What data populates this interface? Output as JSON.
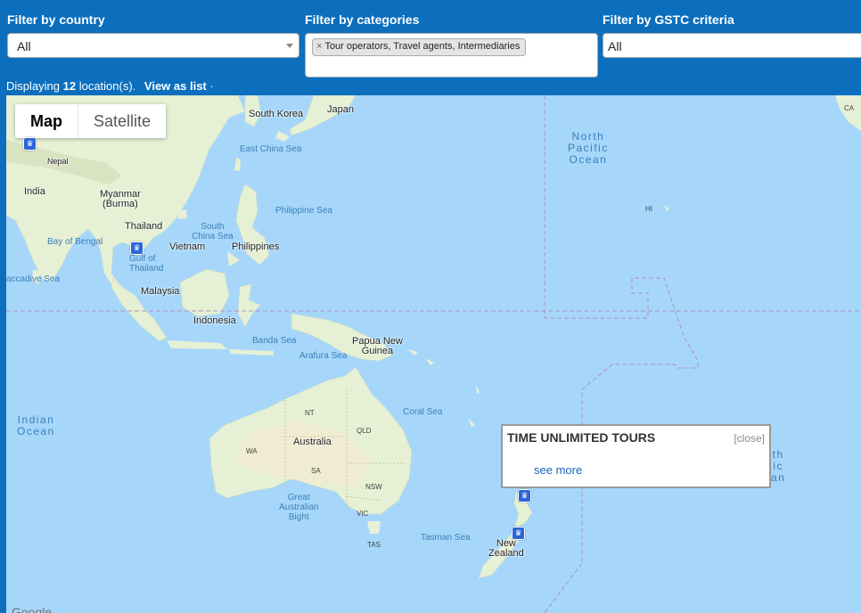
{
  "filters": {
    "country": {
      "label": "Filter by country",
      "value": "All"
    },
    "categories": {
      "label": "Filter by categories",
      "chip_remove": "×",
      "chip": "Tour operators, Travel agents, Intermediaries"
    },
    "gstc": {
      "label": "Filter by GSTC criteria",
      "value": "All"
    }
  },
  "summary": {
    "prefix": "Displaying",
    "count": "12",
    "suffix": "location(s).",
    "view_list": "View as list",
    "bullet": "·"
  },
  "map": {
    "type_control": {
      "map": "Map",
      "satellite": "Satellite"
    },
    "labels": {
      "south_korea": "South Korea",
      "japan": "Japan",
      "east_china_sea": "East China Sea",
      "nepal": "Nepal",
      "india": "India",
      "myanmar": "Myanmar\n(Burma)",
      "thailand": "Thailand",
      "bay_of_bengal": "Bay of Bengal",
      "gulf_of_thailand": "Gulf of\nThailand",
      "vietnam": "Vietnam",
      "south_china_sea": "South\nChina Sea",
      "philippines": "Philippines",
      "philippine_sea": "Philippine Sea",
      "laccadive_sea": "accadive Sea",
      "malaysia": "Malaysia",
      "indonesia": "Indonesia",
      "banda_sea": "Banda Sea",
      "arafura_sea": "Arafura Sea",
      "png": "Papua New\nGuinea",
      "north_pacific": "North\nPacific\nOcean",
      "hi": "HI",
      "indian_ocean": "Indian\nOcean",
      "coral_sea": "Coral Sea",
      "australia": "Australia",
      "nt": "NT",
      "qld": "QLD",
      "wa": "WA",
      "sa": "SA",
      "nsw": "NSW",
      "vic": "VIC",
      "tas": "TAS",
      "great_bight": "Great\nAustralian\nBight",
      "tasman_sea": "Tasman Sea",
      "new_zealand": "New\nZealand",
      "ca": "CA",
      "partial_ocean": "th\nic\nan",
      "google": "Google"
    },
    "infowindow": {
      "title": "TIME UNLIMITED TOURS",
      "close": "[close]",
      "more": "see more"
    }
  },
  "colors": {
    "header_bg": "#0b6fbe",
    "water": "#a6d7fb",
    "land": "#e6f0d4",
    "marker": "#2b65d9"
  }
}
